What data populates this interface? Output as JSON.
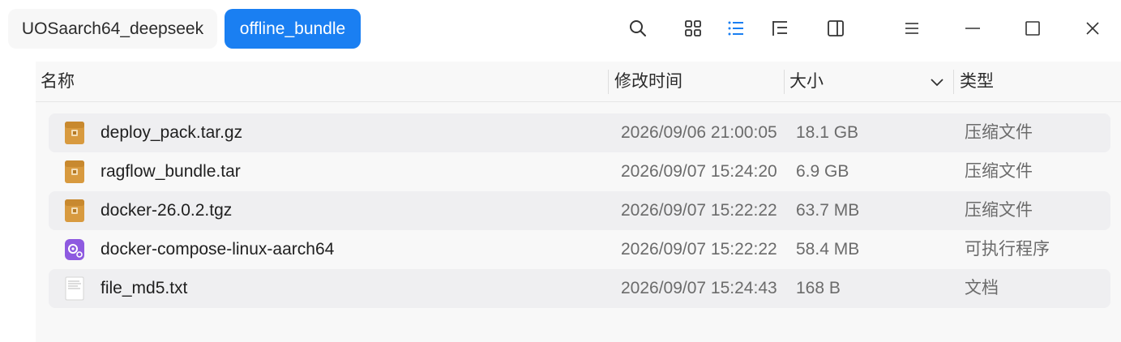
{
  "breadcrumb": {
    "items": [
      {
        "label": "UOSaarch64_deepseek"
      },
      {
        "label": "offline_bundle"
      }
    ]
  },
  "toolbar": {
    "icons": [
      "search-icon",
      "icon-view-icon",
      "list-view-icon",
      "tree-view-icon",
      "preview-panel-icon",
      "menu-icon",
      "minimize-icon",
      "maximize-icon",
      "close-icon"
    ]
  },
  "table": {
    "headers": {
      "name": "名称",
      "modified": "修改时间",
      "size": "大小",
      "type": "类型"
    },
    "rows": [
      {
        "name": "deploy_pack.tar.gz",
        "modified": "2026/09/06 21:00:05",
        "size": "18.1 GB",
        "type": "压缩文件",
        "icon": "archive-icon"
      },
      {
        "name": "ragflow_bundle.tar",
        "modified": "2026/09/07 15:24:20",
        "size": "6.9 GB",
        "type": "压缩文件",
        "icon": "archive-icon"
      },
      {
        "name": "docker-26.0.2.tgz",
        "modified": "2026/09/07 15:22:22",
        "size": "63.7 MB",
        "type": "压缩文件",
        "icon": "archive-icon"
      },
      {
        "name": "docker-compose-linux-aarch64",
        "modified": "2026/09/07 15:22:22",
        "size": "58.4 MB",
        "type": "可执行程序",
        "icon": "executable-icon"
      },
      {
        "name": "file_md5.txt",
        "modified": "2026/09/07 15:24:43",
        "size": "168 B",
        "type": "文档",
        "icon": "text-document-icon"
      }
    ]
  },
  "colors": {
    "accent": "#1a7ff2",
    "archive": "#c8892f",
    "executable": "#8e5ae0"
  }
}
